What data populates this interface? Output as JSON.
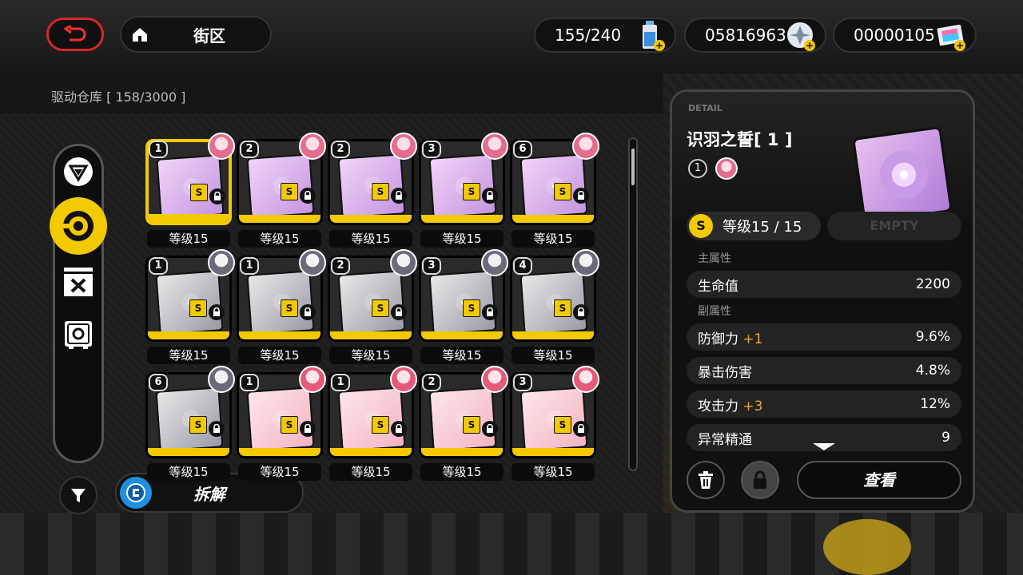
{
  "topbar": {
    "back_icon": "back-arrow-icon",
    "home_icon": "home-icon",
    "location": "街区",
    "battery": "155/240",
    "currency": "05816963",
    "tickets": "00000105",
    "plus": "+"
  },
  "storage": {
    "label": "驱动仓库 [ 158/3000 ]"
  },
  "categories": [
    {
      "name": "triangle-emblem-icon",
      "active": false
    },
    {
      "name": "disc-icon",
      "active": true
    },
    {
      "name": "crossed-box-icon",
      "active": false
    },
    {
      "name": "safe-icon",
      "active": false
    }
  ],
  "actions": {
    "dismantle": "拆解"
  },
  "discs": [
    {
      "rank": "1",
      "level": "等级15",
      "tag": "S",
      "style": "pink"
    },
    {
      "rank": "2",
      "level": "等级15",
      "tag": "S",
      "style": "pink"
    },
    {
      "rank": "2",
      "level": "等级15",
      "tag": "S",
      "style": "pink"
    },
    {
      "rank": "3",
      "level": "等级15",
      "tag": "S",
      "style": "pink"
    },
    {
      "rank": "6",
      "level": "等级15",
      "tag": "S",
      "style": "pink"
    },
    {
      "rank": "1",
      "level": "等级15",
      "tag": "S",
      "style": "blue"
    },
    {
      "rank": "1",
      "level": "等级15",
      "tag": "S",
      "style": "blue"
    },
    {
      "rank": "2",
      "level": "等级15",
      "tag": "S",
      "style": "blue"
    },
    {
      "rank": "3",
      "level": "等级15",
      "tag": "S",
      "style": "blue"
    },
    {
      "rank": "4",
      "level": "等级15",
      "tag": "S",
      "style": "blue"
    },
    {
      "rank": "6",
      "level": "等级15",
      "tag": "S",
      "style": "blue"
    },
    {
      "rank": "1",
      "level": "等级15",
      "tag": "S",
      "style": "red"
    },
    {
      "rank": "1",
      "level": "等级15",
      "tag": "S",
      "style": "red"
    },
    {
      "rank": "2",
      "level": "等级15",
      "tag": "S",
      "style": "red"
    },
    {
      "rank": "3",
      "level": "等级15",
      "tag": "S",
      "style": "red"
    }
  ],
  "detail": {
    "caption": "DETAIL",
    "title": "识羽之誓[ 1 ]",
    "rank": "1",
    "level_badge": "S",
    "level": "等级15 / 15",
    "empty_slot": "EMPTY",
    "main_stat_label": "主属性",
    "main_stat": {
      "name": "生命值",
      "value": "2200"
    },
    "sub_stat_label": "副属性",
    "sub_stats": [
      {
        "name": "防御力",
        "bonus": "+1",
        "value": "9.6%"
      },
      {
        "name": "暴击伤害",
        "bonus": "",
        "value": "4.8%"
      },
      {
        "name": "攻击力",
        "bonus": "+3",
        "value": "12%"
      },
      {
        "name": "异常精通",
        "bonus": "",
        "value": "9"
      }
    ],
    "view_button": "查看"
  }
}
